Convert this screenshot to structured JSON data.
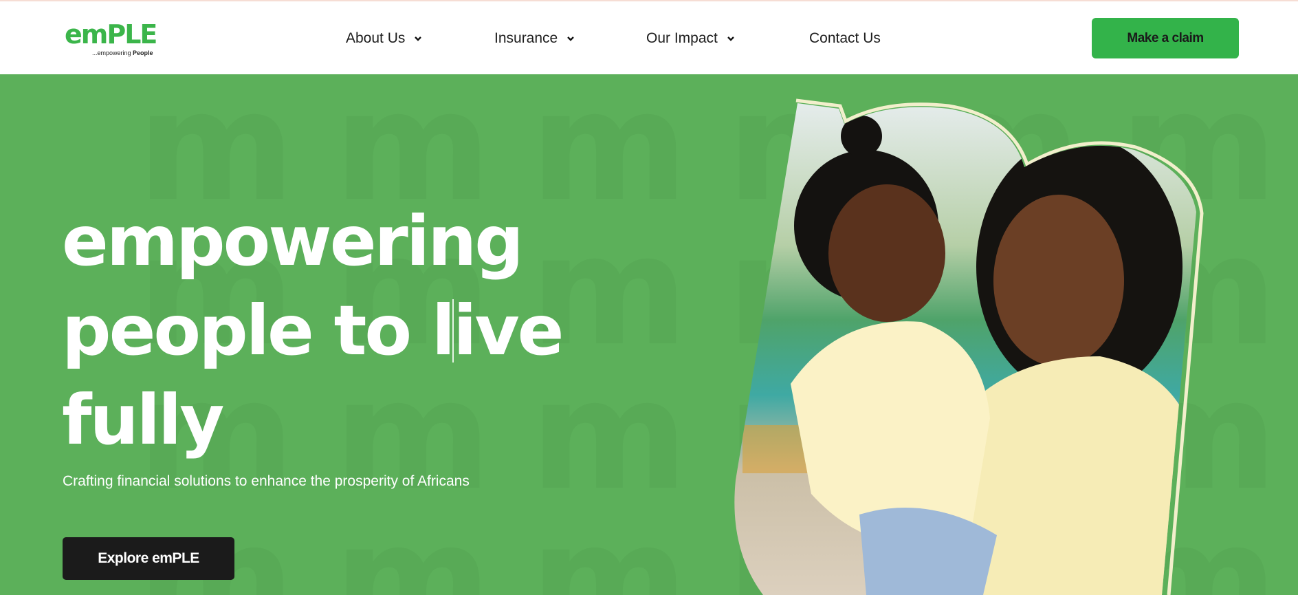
{
  "brand": {
    "logo_text": "emPLE",
    "tagline_prefix": "...empowering",
    "tagline_bold": "People",
    "color": "#3bb54a"
  },
  "nav": {
    "items": [
      {
        "label": "About Us",
        "has_dropdown": true
      },
      {
        "label": "Insurance",
        "has_dropdown": true
      },
      {
        "label": "Our Impact",
        "has_dropdown": true
      },
      {
        "label": "Contact Us",
        "has_dropdown": false
      }
    ],
    "cta": "Make a claim"
  },
  "hero": {
    "headline_line1": "empowering",
    "headline_line2a": "people to l",
    "headline_line2b": "ive",
    "headline_line3": "fully",
    "subtitle": "Crafting financial solutions to enhance the prosperity of Africans",
    "button": "Explore emPLE",
    "background_color": "#5cb05a"
  }
}
